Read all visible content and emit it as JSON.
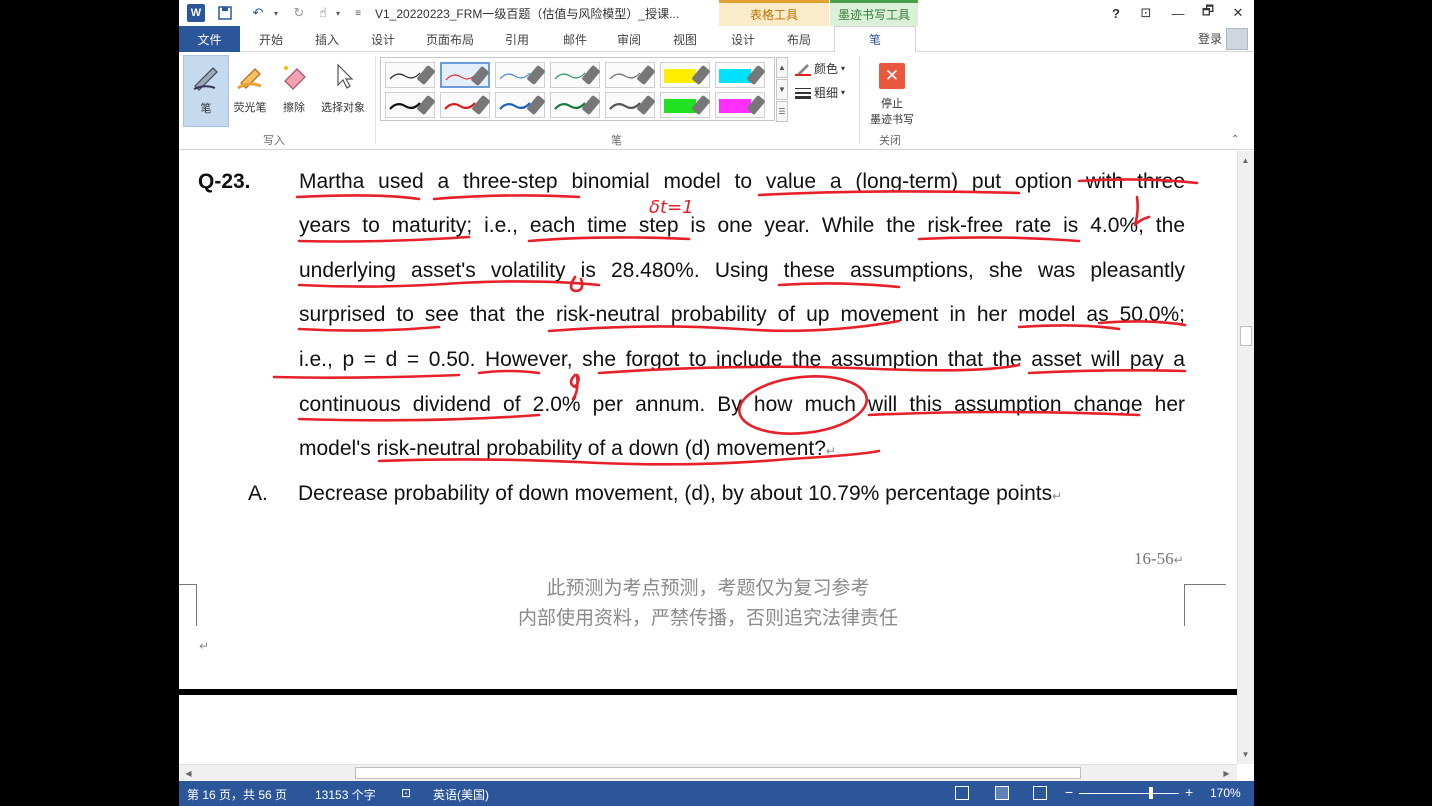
{
  "titlebar": {
    "doc_title": "V1_20220223_FRM一级百题（估值与风险模型）_授课...",
    "ctx_table_tools": "表格工具",
    "ctx_ink_tools": "墨迹书写工具",
    "help": "?",
    "restore_ribbon": "⊡",
    "minimize": "—",
    "restore": "🗗",
    "close": "✕"
  },
  "tabs": {
    "file": "文件",
    "home": "开始",
    "insert": "插入",
    "design": "设计",
    "layout": "页面布局",
    "references": "引用",
    "mailings": "邮件",
    "review": "审阅",
    "view": "视图",
    "table_design": "设计",
    "table_layout": "布局",
    "pen": "笔",
    "login": "登录"
  },
  "ribbon": {
    "write_group": {
      "label": "写入",
      "pen": "笔",
      "highlighter": "荧光笔",
      "eraser": "擦除",
      "select_objects": "选择对象"
    },
    "pens_group": {
      "label": "笔",
      "color": "颜色",
      "thickness": "粗细",
      "swatches_top": [
        "#333333",
        "#e04040",
        "#5b8fd6",
        "#3c9a6a",
        "#777777",
        "#ffee00",
        "#00e0ff"
      ],
      "swatches_bottom": [
        "#111111",
        "#d42020",
        "#2060c0",
        "#1a7a3a",
        "#555555",
        "#22e022",
        "#ff30ff"
      ]
    },
    "close_group": {
      "label": "关闭",
      "stop_inking_line1": "停止",
      "stop_inking_line2": "墨迹书写"
    }
  },
  "document": {
    "question_number": "Q-23.",
    "lines": [
      "Martha used a three-step binomial model to value a (long-term) put option with three",
      "years to maturity; i.e., each time step is one year. While the risk-free rate is 4.0%, the",
      "underlying asset's volatility is 28.480%. Using these assumptions, she was pleasantly",
      "surprised to see that the risk-neutral probability of up movement in her model as 50.0%;",
      "i.e., p = d = 0.50. However, she forgot to include the assumption that the asset will pay a",
      "continuous dividend of 2.0% per annum. By how much will this assumption change her",
      "model's risk-neutral probability of a down (d) movement?"
    ],
    "return_mark": "↵",
    "answer_a_letter": "A.",
    "answer_a_text": "Decrease probability of down movement, (d), by about 10.79% percentage points",
    "page_number": "16-56",
    "footer_line1": "此预测为考点预测，考题仅为复习参考",
    "footer_line2": "内部使用资料，严禁传播，否则追究法律责任",
    "ink_notes": {
      "delta_t": "δt=1",
      "r_note": "r",
      "sigma": "σ",
      "q_note": "q"
    },
    "ink_color": "#e8202a"
  },
  "statusbar": {
    "page": "第 16 页，共 56 页",
    "words": "13153 个字",
    "language": "英语(美国)",
    "zoom": "170%",
    "zoom_fraction": 0.72
  }
}
